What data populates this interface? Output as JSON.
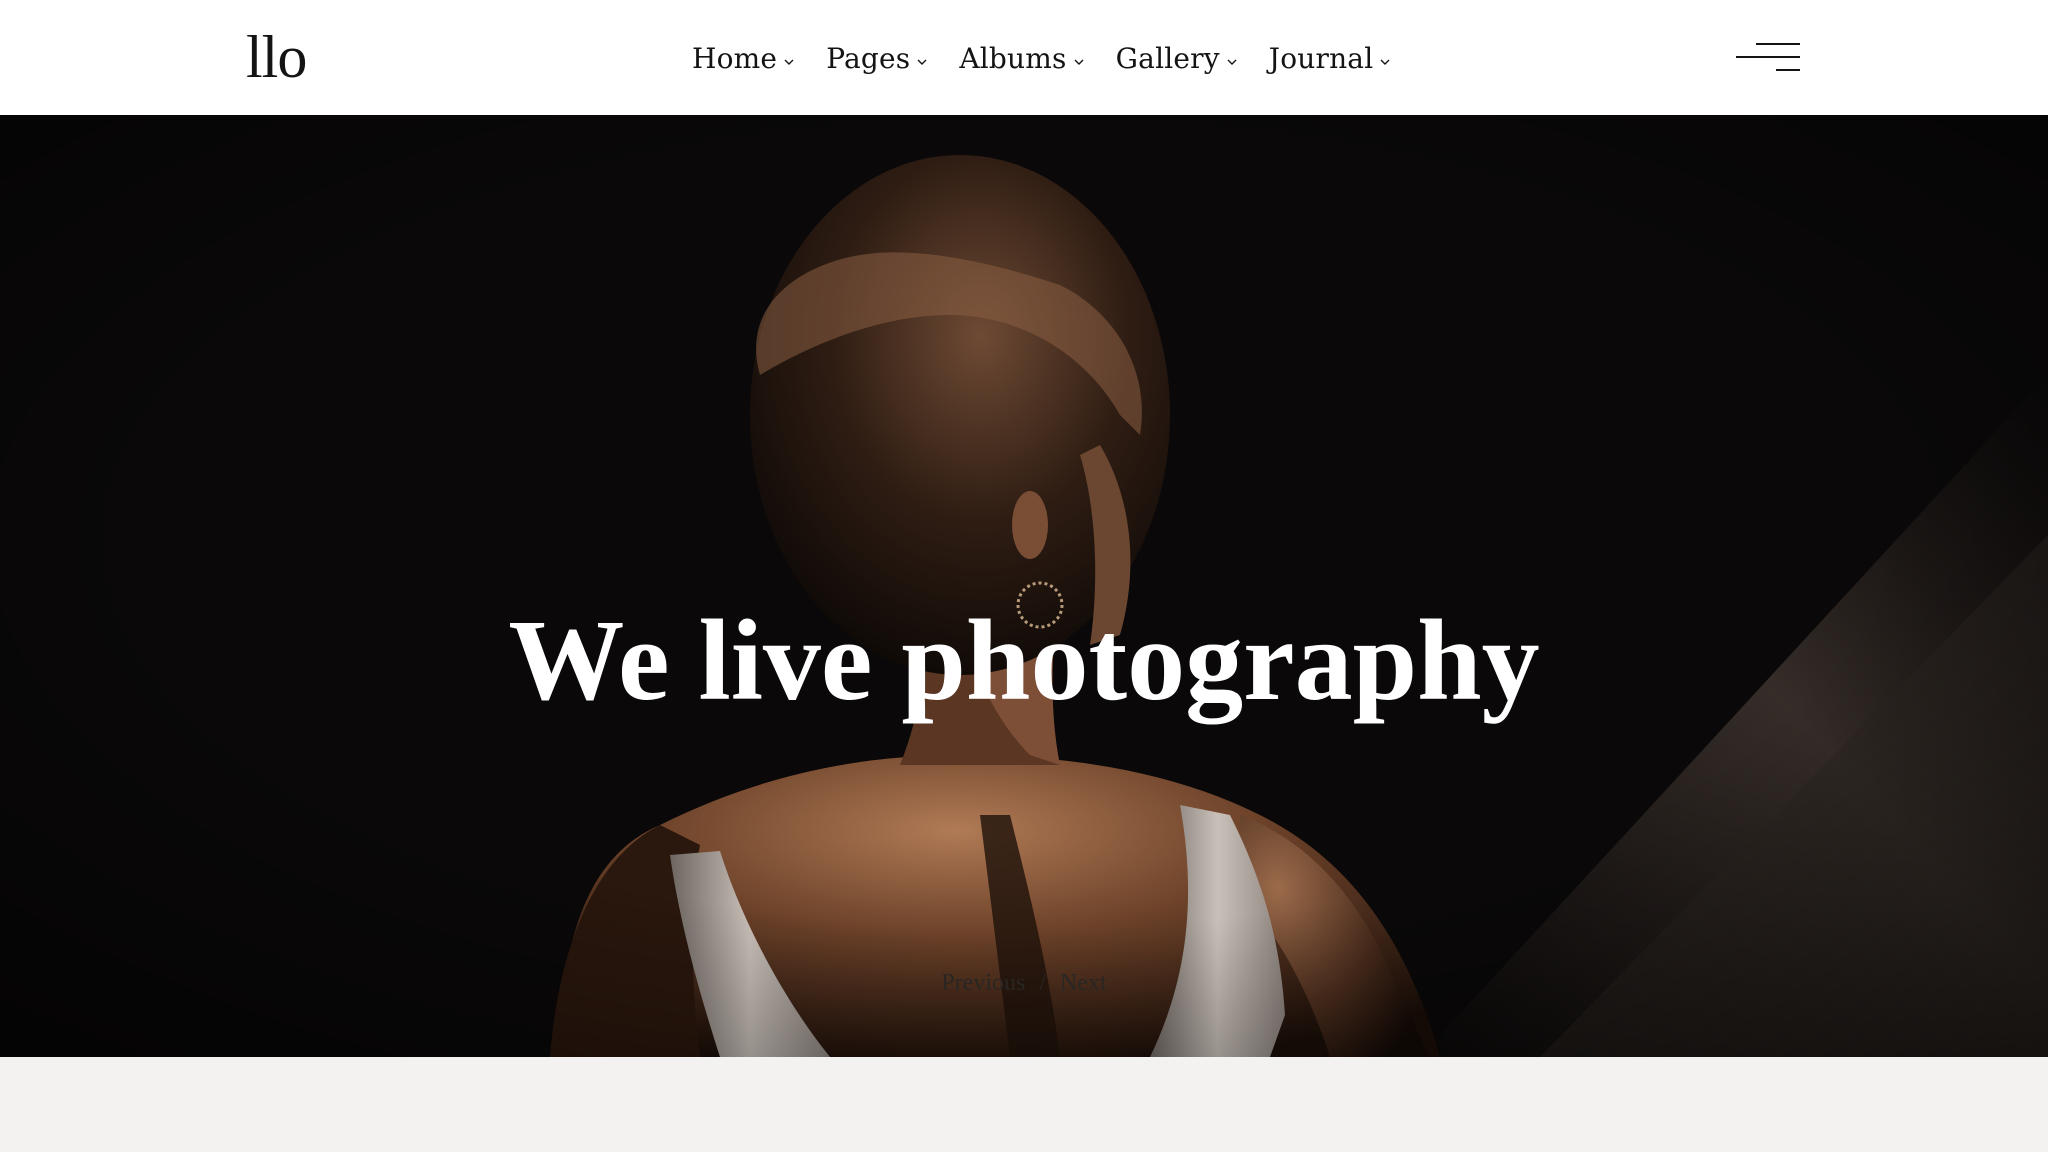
{
  "header": {
    "logo": "llo",
    "nav": [
      {
        "label": "Home"
      },
      {
        "label": "Pages"
      },
      {
        "label": "Albums"
      },
      {
        "label": "Gallery"
      },
      {
        "label": "Journal"
      }
    ],
    "menu_icon": "hamburger-menu-icon",
    "dropdown_icon": "chevron-down-icon"
  },
  "hero": {
    "title": "We live photography",
    "previous_label": "Previous",
    "separator": "/",
    "next_label": "Next"
  },
  "colors": {
    "header_bg": "#ffffff",
    "text_dark": "#141414",
    "hero_bg": "#080707",
    "hero_text": "#ffffff",
    "page_bg": "#f3f2f1"
  }
}
